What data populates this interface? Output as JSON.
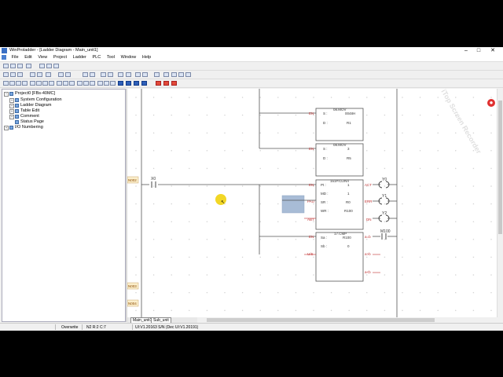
{
  "window": {
    "title": "WinProladder - [Ladder Diagram - Main_unit1]",
    "icon": "app-icon"
  },
  "menu": [
    "File",
    "Edit",
    "View",
    "Project",
    "Ladder",
    "PLC",
    "Tool",
    "Window",
    "Help"
  ],
  "tree": {
    "root": "Project0 [FBs-40MC]",
    "items": [
      "System Configuration",
      "Ladder Diagram",
      "Table Edit",
      "Comment",
      "Status Page",
      "I/O Numbering"
    ]
  },
  "ladder": {
    "rungs": [
      "N002",
      "N003",
      "N004"
    ],
    "contacts": {
      "input": "X0",
      "y0": "Y0",
      "y1": "Y1",
      "y2": "Y2",
      "m100": "M100"
    },
    "blocks": [
      {
        "title": "08.MOV",
        "s_label": "S :",
        "s_val": "0048H",
        "d_label": "D :",
        "d_val": "R1"
      },
      {
        "title": "08.MOV",
        "s_label": "S :",
        "s_val": "3",
        "d_label": "D :",
        "d_val": "R5"
      },
      {
        "title": "151P.CLIN4",
        "rows": [
          [
            "Pt :",
            "1"
          ],
          [
            "MD :",
            "1"
          ],
          [
            "SR :",
            "R0"
          ],
          [
            "WR :",
            "R100"
          ]
        ]
      },
      {
        "title": "17.CMP",
        "rows": [
          [
            "Sa :",
            "R100"
          ],
          [
            "Sb :",
            "0"
          ]
        ]
      }
    ],
    "pins": {
      "en": "EN",
      "pau": "PAU",
      "abt": "ABT",
      "uds": "U/S",
      "act": "ACT",
      "err": "ERR",
      "dn": "DN",
      "ab": "a=b",
      "agb": "a>b",
      "alb": "a<b"
    }
  },
  "tabs": [
    "Main_unit1",
    "Sub_unit"
  ],
  "status": {
    "mode": "Overwrite",
    "pos": "N2 R:2 C:7",
    "ver": "UI:V1.20163 S/N (Dec UI:V1.20191)"
  },
  "watermark": "iTop Screen Recorder",
  "colors": {
    "pin": "#c03030",
    "block_border": "#555555",
    "highlight": "#a8bcd6",
    "cursor": "#f0d000"
  }
}
